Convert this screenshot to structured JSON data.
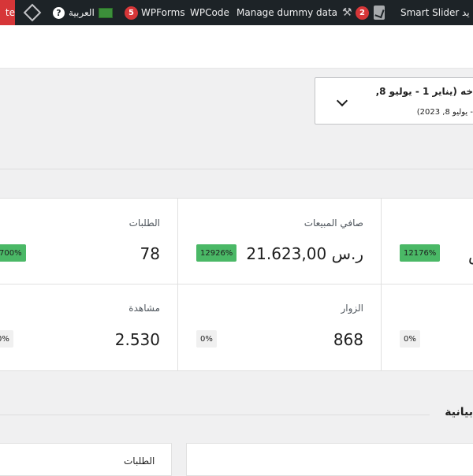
{
  "adminbar": {
    "update_text": "te",
    "language_label": "العربية",
    "help_label": "?",
    "wpforms_count": "5",
    "wpforms_label": "WPForms",
    "wpcode_label": "WPCode",
    "dummy_label": "Manage dummy data",
    "yoast_count": "2",
    "smartslider_label": "Smart Slider",
    "new_label": "يد"
  },
  "date_range": {
    "line1": "خه (يناير 1 - يوليو 8,",
    "line2": "- يوليو 8, 2023)"
  },
  "stats": [
    {
      "label": "الطلبات",
      "value": "78",
      "delta": "700%"
    },
    {
      "label": "صافي المبيعات",
      "value": "21.623,00 ر.س",
      "delta": "12926%"
    },
    {
      "label": "",
      "value": "س",
      "delta": "12176%"
    },
    {
      "label": "مشاهدة",
      "value": "2.530",
      "delta": "0%"
    },
    {
      "label": "الزوار",
      "value": "868",
      "delta": "0%"
    },
    {
      "label": "",
      "value": "",
      "delta": "0%"
    }
  ],
  "charts": {
    "title": "بيانية",
    "card_label": "الطلبات"
  },
  "colors": {
    "adminbar_bg": "#1d2327",
    "update_red": "#d63638",
    "delta_green": "#4ab866",
    "delta_gray": "#f0f0f0"
  }
}
